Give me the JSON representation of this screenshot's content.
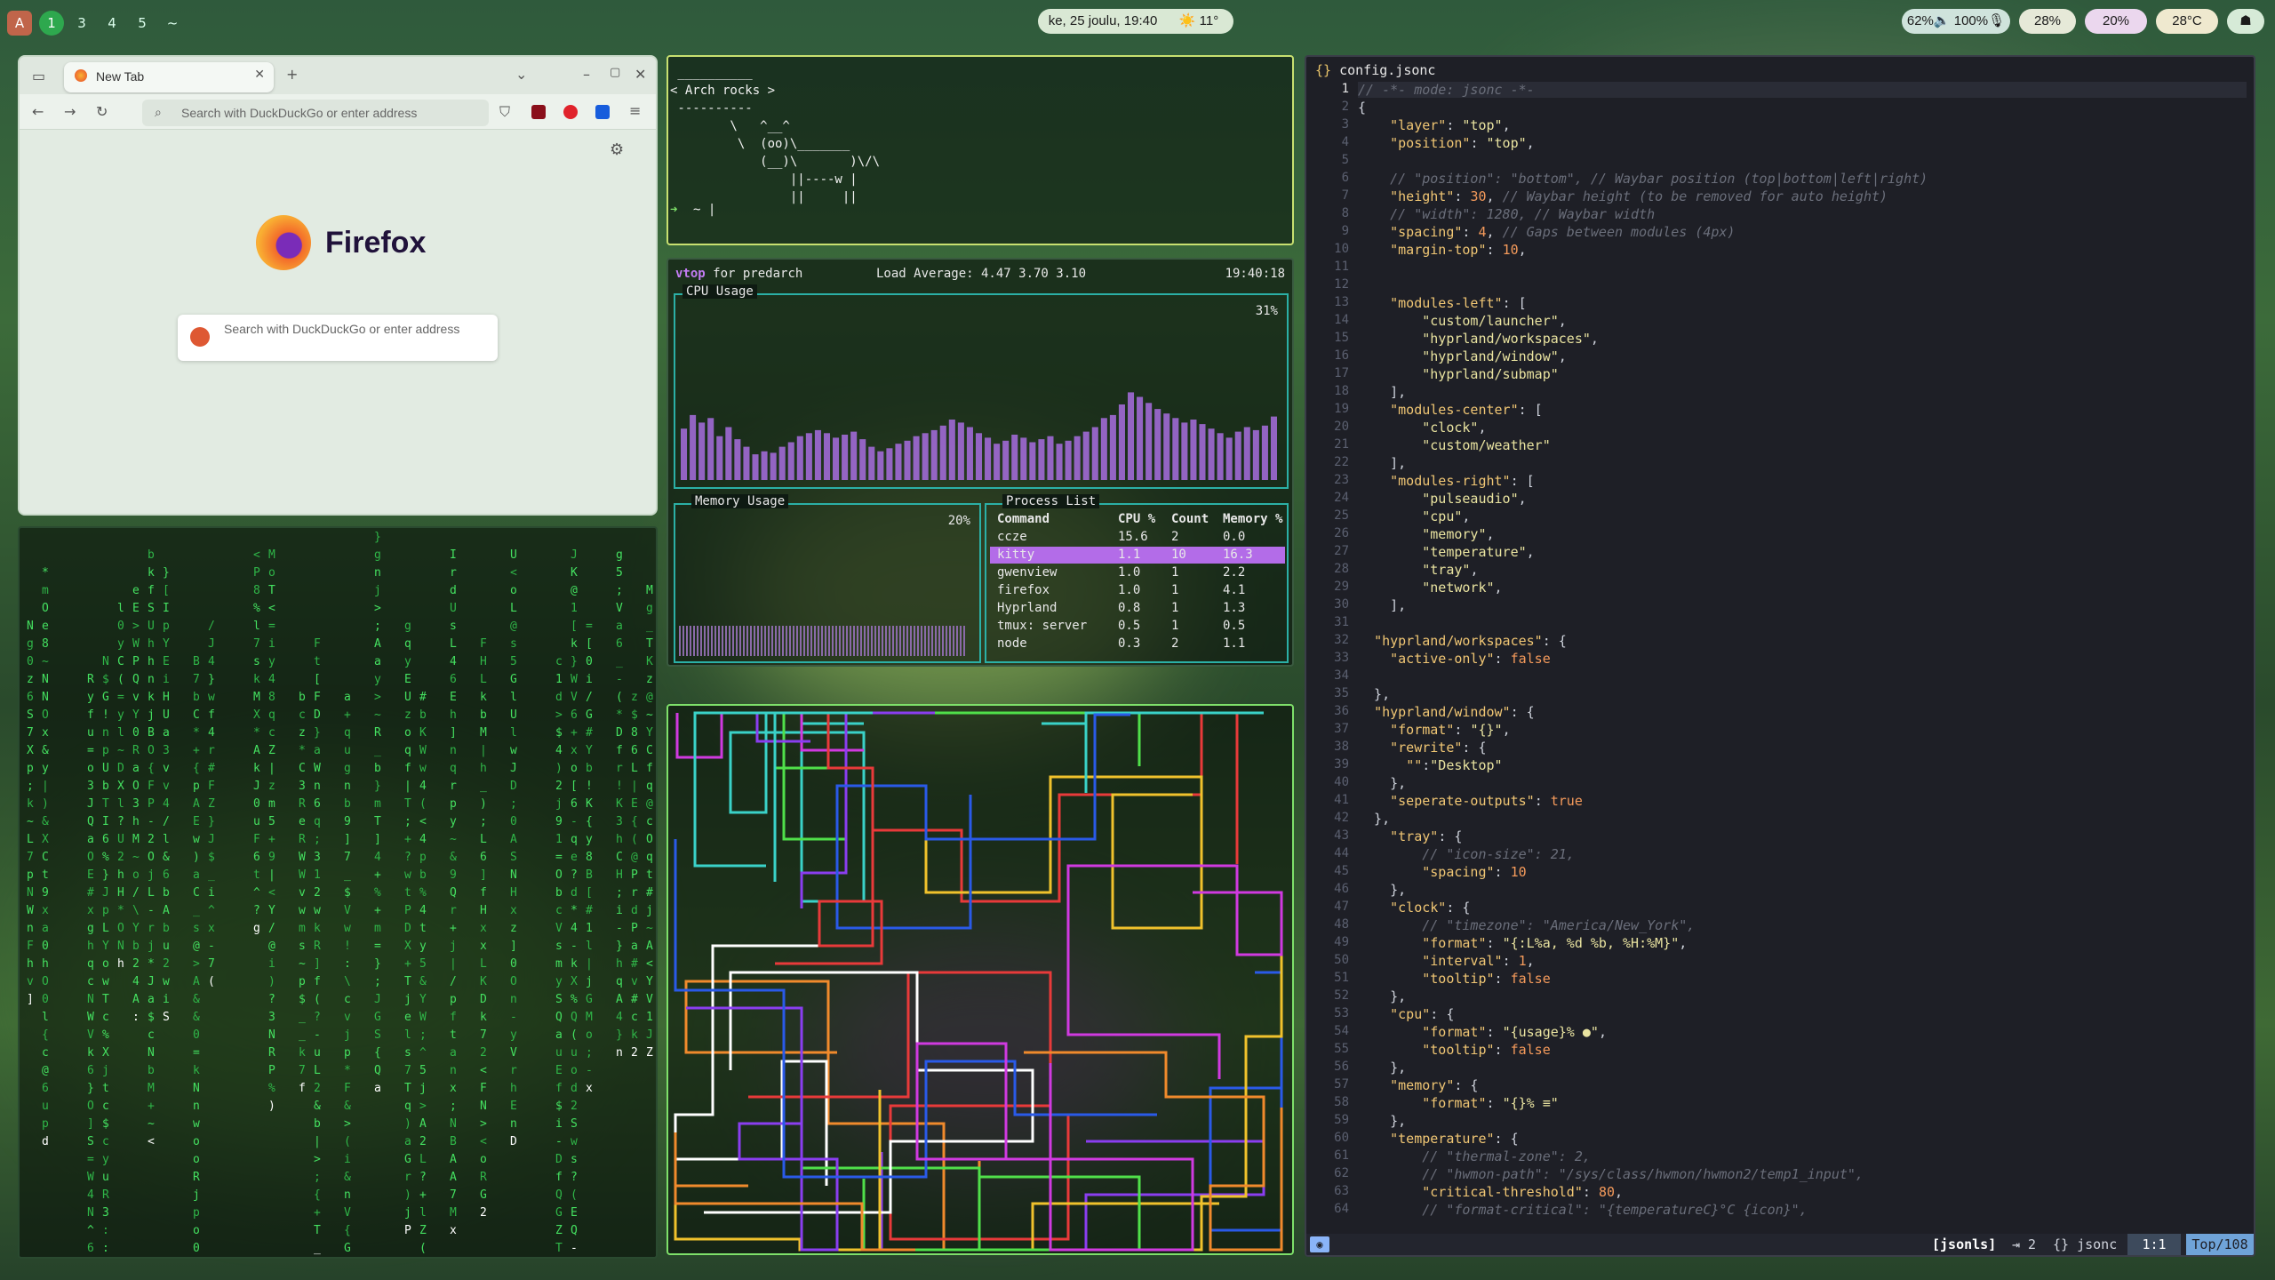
{
  "topbar": {
    "launcher": "A",
    "workspaces": [
      "1",
      "3",
      "4",
      "5",
      "~"
    ],
    "active_workspace": "1",
    "clock": "ke, 25 joulu, 19:40",
    "weather": "☀️ 11°",
    "audio": "62%🔈 100%🎙",
    "cpu": "28%",
    "memory": "20%",
    "temperature": "28°C",
    "network_icon": "network-icon",
    "colors": {
      "accent": "#7fbf86",
      "active_ws": "#2ea84e"
    }
  },
  "firefox": {
    "tab_title": "New Tab",
    "url_placeholder": "Search with DuckDuckGo or enter address",
    "brand": "Firefox",
    "search_placeholder": "Search with DuckDuckGo or enter address"
  },
  "cowsay": {
    "lines": [
      " __________",
      "< Arch rocks >",
      " ----------",
      "        \\   ^__^",
      "         \\  (oo)\\_______",
      "            (__)\\       )\\/\\",
      "                ||----w |",
      "                ||     ||"
    ],
    "prompt": "~ |"
  },
  "vtop": {
    "app": "vtop",
    "host": "for predarch",
    "load": "Load Average: 4.47 3.70 3.10",
    "time": "19:40:18",
    "cpu_title": "CPU Usage",
    "cpu_percent": "31%",
    "cpu_series": [
      0.34,
      0.43,
      0.38,
      0.41,
      0.29,
      0.35,
      0.27,
      0.22,
      0.17,
      0.19,
      0.18,
      0.22,
      0.25,
      0.29,
      0.31,
      0.33,
      0.31,
      0.28,
      0.3,
      0.32,
      0.27,
      0.22,
      0.19,
      0.21,
      0.24,
      0.26,
      0.29,
      0.31,
      0.33,
      0.36,
      0.4,
      0.38,
      0.35,
      0.31,
      0.28,
      0.24,
      0.26,
      0.3,
      0.28,
      0.25,
      0.27,
      0.29,
      0.24,
      0.26,
      0.29,
      0.32,
      0.35,
      0.41,
      0.43,
      0.5,
      0.58,
      0.55,
      0.51,
      0.47,
      0.44,
      0.41,
      0.38,
      0.4,
      0.37,
      0.34,
      0.31,
      0.28,
      0.32,
      0.35,
      0.33,
      0.36,
      0.42
    ],
    "mem_title": "Memory Usage",
    "mem_percent": "20%",
    "mem_fraction": 0.2,
    "proc_title": "Process List",
    "columns": [
      "Command",
      "CPU %",
      "Count",
      "Memory %"
    ],
    "rows": [
      [
        "ccze",
        "15.6",
        "2",
        "0.0"
      ],
      [
        "kitty",
        "1.1",
        "10",
        "16.3"
      ],
      [
        "gwenview",
        "1.0",
        "1",
        "2.2"
      ],
      [
        "firefox",
        "1.0",
        "1",
        "4.1"
      ],
      [
        "Hyprland",
        "0.8",
        "1",
        "1.3"
      ],
      [
        "tmux: server",
        "0.5",
        "1",
        "0.5"
      ],
      [
        "node",
        "0.3",
        "2",
        "1.1"
      ]
    ],
    "selected_row": 1
  },
  "editor": {
    "filename": "config.jsonc",
    "lines": [
      "// -*- mode: jsonc -*-",
      "{",
      "    \"layer\": \"top\",",
      "    \"position\": \"top\",",
      "",
      "    // \"position\": \"bottom\", // Waybar position (top|bottom|left|right)",
      "    \"height\": 30, // Waybar height (to be removed for auto height)",
      "    // \"width\": 1280, // Waybar width",
      "    \"spacing\": 4, // Gaps between modules (4px)",
      "    \"margin-top\": 10,",
      "",
      "",
      "    \"modules-left\": [",
      "        \"custom/launcher\",",
      "        \"hyprland/workspaces\",",
      "        \"hyprland/window\",",
      "        \"hyprland/submap\"",
      "    ],",
      "    \"modules-center\": [",
      "        \"clock\",",
      "        \"custom/weather\"",
      "    ],",
      "    \"modules-right\": [",
      "        \"pulseaudio\",",
      "        \"cpu\",",
      "        \"memory\",",
      "        \"temperature\",",
      "        \"tray\",",
      "        \"network\",",
      "    ],",
      "",
      "  \"hyprland/workspaces\": {",
      "    \"active-only\": false",
      "",
      "  },",
      "  \"hyprland/window\": {",
      "    \"format\": \"{}\",",
      "    \"rewrite\": {",
      "      \"\":\"Desktop\"",
      "    },",
      "    \"seperate-outputs\": true",
      "  },",
      "    \"tray\": {",
      "        // \"icon-size\": 21,",
      "        \"spacing\": 10",
      "    },",
      "    \"clock\": {",
      "        // \"timezone\": \"America/New_York\",",
      "        \"format\": \"{:L%a, %d %b, %H:%M}\",",
      "        \"interval\": 1,",
      "        \"tooltip\": false",
      "    },",
      "    \"cpu\": {",
      "        \"format\": \"{usage}% ●\",",
      "        \"tooltip\": false",
      "    },",
      "    \"memory\": {",
      "        \"format\": \"{}% ≡\"",
      "    },",
      "    \"temperature\": {",
      "        // \"thermal-zone\": 2,",
      "        // \"hwmon-path\": \"/sys/class/hwmon/hwmon2/temp1_input\",",
      "        \"critical-threshold\": 80,",
      "        // \"format-critical\": \"{temperatureC}°C {icon}\","
    ],
    "status_mode": "[jsonls]",
    "status_indent": "⇥ 2",
    "status_ft": "{} jsonc",
    "status_pos": "1:1",
    "status_scroll": "Top/108"
  }
}
